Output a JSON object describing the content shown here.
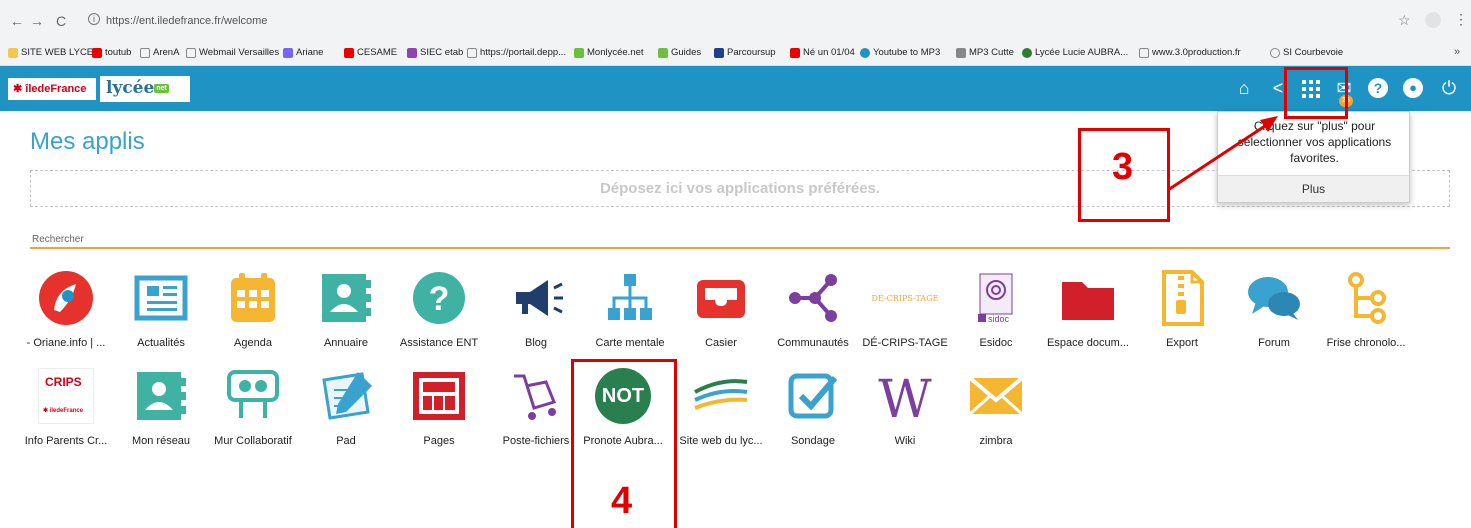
{
  "browser": {
    "url": "https://ent.iledefrance.fr/welcome",
    "bookmarks": [
      "SITE WEB LYCEE",
      "toutub",
      "ArenA",
      "Webmail Versailles",
      "Ariane",
      "CESAME",
      "SIEC etab",
      "https://portail.depp...",
      "Monlycée.net",
      "Guides",
      "Parcoursup",
      "Né un 01/04",
      "Youtube to MP3",
      "MP3 Cutte",
      "Lycée Lucie AUBRA...",
      "www.3.0production.fr",
      "SI Courbevoie"
    ]
  },
  "header": {
    "brand_idf": "✱ îledeFrance",
    "brand_lycee": "lycée",
    "brand_net": "net",
    "mail_count": "25"
  },
  "tooltip": {
    "message": "Cliquez sur \"plus\" pour sélectionner vos applications favorites.",
    "plus_label": "Plus"
  },
  "main": {
    "title": "Mes applis",
    "dropzone": "Déposez ici vos applications préférées.",
    "search_label": "Rechercher"
  },
  "apps": [
    {
      "label": "- Oriane.info | ...",
      "icon": "oriane-icon"
    },
    {
      "label": "Actualités",
      "icon": "news-icon"
    },
    {
      "label": "Agenda",
      "icon": "calendar-icon"
    },
    {
      "label": "Annuaire",
      "icon": "directory-icon"
    },
    {
      "label": "Assistance ENT",
      "icon": "help-icon"
    },
    {
      "label": "Blog",
      "icon": "megaphone-icon"
    },
    {
      "label": "Carte mentale",
      "icon": "org-chart-icon"
    },
    {
      "label": "Casier",
      "icon": "inbox-icon"
    },
    {
      "label": "Communautés",
      "icon": "share-icon"
    },
    {
      "label": "DÉ-CRIPS-TAGE",
      "icon": "decripstage-logo"
    },
    {
      "label": "Esidoc",
      "icon": "esidoc-logo"
    },
    {
      "label": "Espace docum...",
      "icon": "folder-icon"
    },
    {
      "label": "Export",
      "icon": "zip-icon"
    },
    {
      "label": "Forum",
      "icon": "chat-icon"
    },
    {
      "label": "Frise chronolo...",
      "icon": "timeline-icon"
    },
    {
      "label": "Info Parents Cr...",
      "icon": "crips-logo"
    },
    {
      "label": "Mon réseau",
      "icon": "contacts-icon"
    },
    {
      "label": "Mur Collaboratif",
      "icon": "collab-wall-icon"
    },
    {
      "label": "Pad",
      "icon": "pad-icon"
    },
    {
      "label": "Pages",
      "icon": "pages-icon"
    },
    {
      "label": "Poste-fichiers",
      "icon": "cart-icon"
    },
    {
      "label": "Pronote Aubra...",
      "icon": "pronote-icon"
    },
    {
      "label": "Site web du lyc...",
      "icon": "website-icon"
    },
    {
      "label": "Sondage",
      "icon": "poll-icon"
    },
    {
      "label": "Wiki",
      "icon": "wiki-icon"
    },
    {
      "label": "zimbra",
      "icon": "mail-icon"
    }
  ],
  "icon_text": {
    "decrips": "DÉ-CRIPS-TAGE",
    "esidoc": "sidoc",
    "crips_top": "CRIPS",
    "crips_bottom": "✱ îledeFrance",
    "pronote": "NOT",
    "wiki": "W"
  },
  "annotations": {
    "step3": "3",
    "step4": "4"
  },
  "colors": {
    "header_bg": "#1f94c4",
    "title": "#3aa2cf",
    "annotation": "#e00000",
    "search_line": "#f2a33a"
  }
}
